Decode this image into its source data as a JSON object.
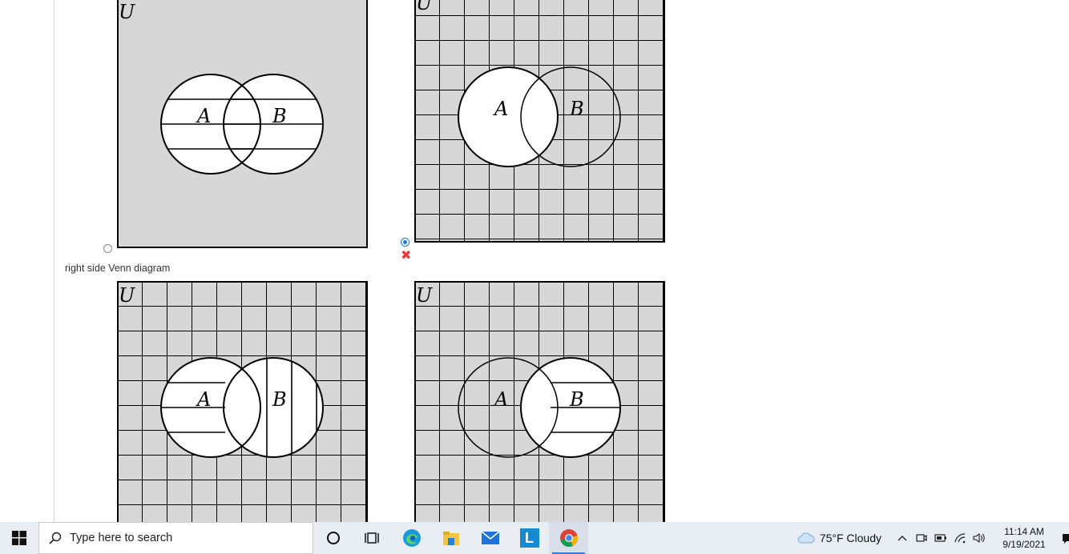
{
  "diagram_labels": {
    "universe": "U",
    "set_a": "A",
    "set_b": "B"
  },
  "caption": "right side Venn diagram",
  "feedback": {
    "icon": "x-mark-icon",
    "color": "#e23b3b",
    "glyph": "✖"
  },
  "options": [
    {
      "id": "top-left",
      "selected": false
    },
    {
      "id": "top-right",
      "selected": true
    },
    {
      "id": "bottom-left",
      "selected": false
    },
    {
      "id": "bottom-right",
      "selected": false
    }
  ],
  "taskbar": {
    "search_placeholder": "Type here to search",
    "apps": [
      "cortana-icon",
      "task-view-icon",
      "edge-icon",
      "file-explorer-icon",
      "mail-icon",
      "l-app-icon",
      "chrome-icon"
    ],
    "l_app_letter": "L",
    "weather": {
      "icon": "cloud-icon",
      "text": "75°F  Cloudy"
    },
    "time": "11:14 AM",
    "date": "9/19/2021"
  },
  "colors": {
    "shade": "#d7d7d7",
    "accent": "#1a73e8",
    "taskbar": "#e9eef5"
  }
}
